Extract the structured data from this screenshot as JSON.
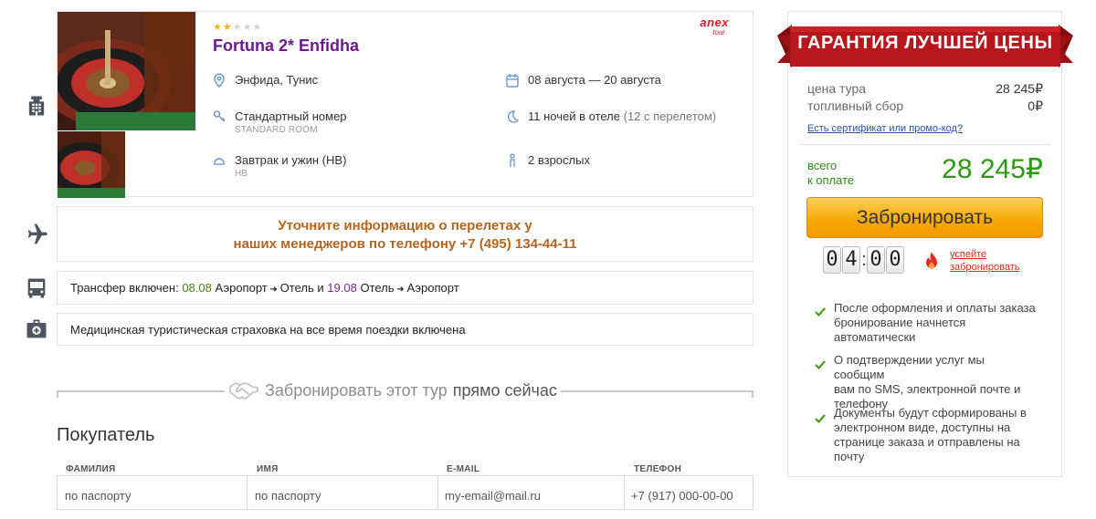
{
  "hotel": {
    "stars_rating": 2,
    "stars_max": 5,
    "name": "Fortuna 2* Enfidha",
    "operator_logo": {
      "line1": "anex",
      "line2": "tour"
    },
    "location": "Энфида, Тунис",
    "dates": "08 августа — 20 августа",
    "room": "Стандартный номер",
    "room_sub": "STANDARD ROOM",
    "nights": "11 ночей в отеле",
    "nights_extra": "(12 с перелетом)",
    "meal": "Завтрак и ужин (HB)",
    "meal_sub": "HB",
    "guests": "2 взрослых"
  },
  "flight": {
    "line1": "Уточните информацию о перелетах у",
    "line2": "наших менеджеров по телефону +7 (495) 134-44-11"
  },
  "transfer": {
    "prefix": "Трансфер включен:",
    "date1": "08.08",
    "route1_from": "Аэропорт",
    "route1_to": "Отель",
    "and": "и",
    "date2": "19.08",
    "route2_from": "Отель",
    "route2_to": "Аэропорт",
    "arrow": "➜"
  },
  "insurance": {
    "text": "Медицинская туристическая страховка на все время поездки включена"
  },
  "book_now": {
    "part1": "Забронировать этот тур",
    "part2": "прямо сейчас"
  },
  "buyer": {
    "title": "Покупатель",
    "fields": [
      {
        "label": "ФАМИЛИЯ",
        "value": "по паспорту"
      },
      {
        "label": "ИМЯ",
        "value": "по паспорту"
      },
      {
        "label": "E-MAIL",
        "value": "my-email@mail.ru"
      },
      {
        "label": "ТЕЛЕФОН",
        "value": "+7 (917) 000-00-00"
      }
    ]
  },
  "price": {
    "ribbon": "ГАРАНТИЯ ЛУЧШЕЙ ЦЕНЫ",
    "tour_label": "цена тура",
    "tour_value": "28 245₽",
    "fuel_label": "топливный сбор",
    "fuel_value": "0₽",
    "promo_link": "Есть сертификат или промо-код?",
    "total_label_1": "всего",
    "total_label_2": "к оплате",
    "total_value": "28 245₽",
    "book_button": "Забронировать",
    "timer_digits": [
      "0",
      "4",
      "0",
      "0"
    ],
    "timer_colon": ":",
    "hurry_1": "успейте",
    "hurry_2": "забронировать",
    "bullets": [
      [
        "После оформления и оплаты заказа",
        "бронирование начнется",
        "автоматически"
      ],
      [
        "О подтверждении услуг мы сообщим",
        "вам по SMS, электронной почте и",
        "телефону"
      ],
      [
        "Документы будут сформированы в",
        "электронном виде, доступны на",
        "странице заказа и отправлены на",
        "почту"
      ]
    ]
  },
  "colors": {
    "hotel_name": "#6a1b8a",
    "flight_text": "#b5651d",
    "total_green": "#2a9a10",
    "ribbon_red": "#b3151b",
    "button_orange": "#f7a700"
  }
}
